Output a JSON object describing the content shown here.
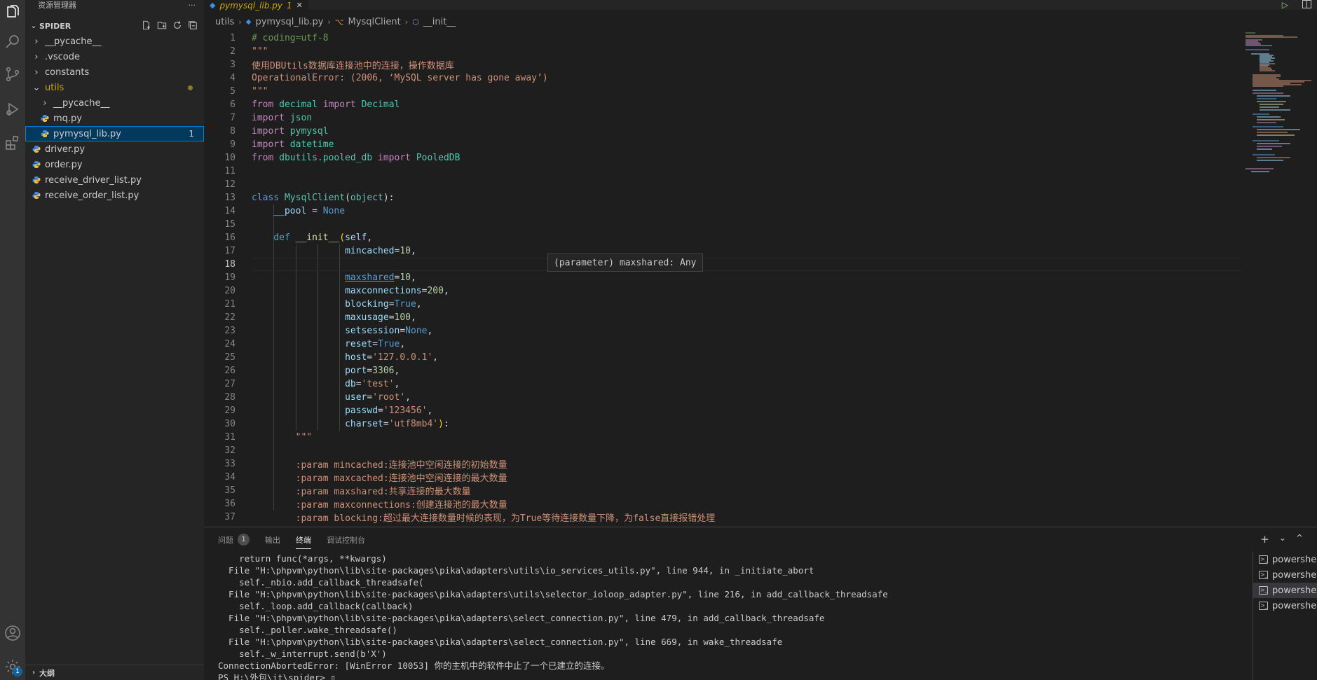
{
  "colors": {
    "accent": "#007fd4",
    "modified": "#cca700",
    "activity_bg": "#333333",
    "sidebar_bg": "#252526",
    "editor_bg": "#1e1e1e"
  },
  "activity_bar": {
    "items": [
      {
        "name": "explorer-icon"
      },
      {
        "name": "search-icon"
      },
      {
        "name": "source-control-icon"
      },
      {
        "name": "run-debug-icon"
      },
      {
        "name": "extensions-icon"
      }
    ],
    "bottom": [
      {
        "name": "account-icon"
      },
      {
        "name": "manage-gear-icon",
        "badge": "1"
      }
    ]
  },
  "sidebar": {
    "title": "资源管理器",
    "more": "···",
    "workspace": "SPIDER",
    "tree": [
      {
        "label": "__pycache__",
        "type": "folder",
        "depth": 0
      },
      {
        "label": ".vscode",
        "type": "folder",
        "depth": 0
      },
      {
        "label": "constants",
        "type": "folder",
        "depth": 0
      },
      {
        "label": "utils",
        "type": "folder-open",
        "depth": 0,
        "modified": true
      },
      {
        "label": "__pycache__",
        "type": "folder",
        "depth": 1
      },
      {
        "label": "mq.py",
        "type": "py",
        "depth": 1
      },
      {
        "label": "pymysql_lib.py",
        "type": "py",
        "depth": 1,
        "selected": true,
        "badge": "1"
      },
      {
        "label": "driver.py",
        "type": "py",
        "depth": 0
      },
      {
        "label": "order.py",
        "type": "py",
        "depth": 0
      },
      {
        "label": "receive_driver_list.py",
        "type": "py",
        "depth": 0
      },
      {
        "label": "receive_order_list.py",
        "type": "py",
        "depth": 0
      }
    ],
    "outline": "大纲"
  },
  "editor": {
    "tab": {
      "label": "pymysql_lib.py",
      "badge": "1",
      "close": "✕"
    },
    "breadcrumb": [
      "utils",
      "pymysql_lib.py",
      "MysqlClient",
      "__init__"
    ],
    "hover": "(parameter) maxshared: Any",
    "current_line": 18,
    "lines": [
      {
        "n": "1",
        "t": [
          [
            "c",
            "# coding=utf-8"
          ]
        ]
      },
      {
        "n": "2",
        "t": [
          [
            "s",
            "\"\"\""
          ]
        ]
      },
      {
        "n": "3",
        "t": [
          [
            "s",
            "使用DBUtils数据库连接池中的连接，操作数据库"
          ]
        ]
      },
      {
        "n": "4",
        "t": [
          [
            "s",
            "OperationalError: (2006, ‘MySQL server has gone away’)"
          ]
        ]
      },
      {
        "n": "5",
        "t": [
          [
            "s",
            "\"\"\""
          ]
        ]
      },
      {
        "n": "6",
        "t": [
          [
            "k",
            "from"
          ],
          [
            "p",
            " "
          ],
          [
            "cls",
            "decimal"
          ],
          [
            "p",
            " "
          ],
          [
            "k",
            "import"
          ],
          [
            "p",
            " "
          ],
          [
            "cls",
            "Decimal"
          ]
        ]
      },
      {
        "n": "7",
        "t": [
          [
            "k",
            "import"
          ],
          [
            "p",
            " "
          ],
          [
            "cls",
            "json"
          ]
        ]
      },
      {
        "n": "8",
        "t": [
          [
            "k",
            "import"
          ],
          [
            "p",
            " "
          ],
          [
            "cls",
            "pymysql"
          ]
        ]
      },
      {
        "n": "9",
        "t": [
          [
            "k",
            "import"
          ],
          [
            "p",
            " "
          ],
          [
            "cls",
            "datetime"
          ]
        ]
      },
      {
        "n": "10",
        "t": [
          [
            "k",
            "from"
          ],
          [
            "p",
            " "
          ],
          [
            "cls",
            "dbutils.pooled_db"
          ],
          [
            "p",
            " "
          ],
          [
            "k",
            "import"
          ],
          [
            "p",
            " "
          ],
          [
            "cls",
            "PooledDB"
          ]
        ]
      },
      {
        "n": "11",
        "t": []
      },
      {
        "n": "12",
        "t": []
      },
      {
        "n": "13",
        "t": [
          [
            "kb",
            "class"
          ],
          [
            "p",
            " "
          ],
          [
            "cls",
            "MysqlClient"
          ],
          [
            "p",
            "("
          ],
          [
            "cls",
            "object"
          ],
          [
            "p",
            "):"
          ]
        ]
      },
      {
        "n": "14",
        "t": [
          [
            "p",
            "    "
          ],
          [
            "v",
            "__pool"
          ],
          [
            "p",
            " = "
          ],
          [
            "cn",
            "None"
          ]
        ]
      },
      {
        "n": "15",
        "t": []
      },
      {
        "n": "16",
        "t": [
          [
            "p",
            "    "
          ],
          [
            "kb",
            "def"
          ],
          [
            "p",
            " "
          ],
          [
            "fn",
            "__init__"
          ],
          [
            "br",
            "("
          ],
          [
            "v",
            "self"
          ],
          [
            "p",
            ","
          ]
        ]
      },
      {
        "n": "17",
        "t": [
          [
            "p",
            "                 "
          ],
          [
            "v",
            "mincached"
          ],
          [
            "p",
            "="
          ],
          [
            "n",
            "10"
          ],
          [
            "p",
            ","
          ]
        ]
      },
      {
        "n": "18",
        "t": []
      },
      {
        "n": "19",
        "t": [
          [
            "p",
            "                 "
          ],
          [
            "v",
            "maxshared"
          ],
          [
            "p",
            "="
          ],
          [
            "n",
            "10"
          ],
          [
            "p",
            ","
          ]
        ]
      },
      {
        "n": "20",
        "t": [
          [
            "p",
            "                 "
          ],
          [
            "v",
            "maxconnections"
          ],
          [
            "p",
            "="
          ],
          [
            "n",
            "200"
          ],
          [
            "p",
            ","
          ]
        ]
      },
      {
        "n": "21",
        "t": [
          [
            "p",
            "                 "
          ],
          [
            "v",
            "blocking"
          ],
          [
            "p",
            "="
          ],
          [
            "cn",
            "True"
          ],
          [
            "p",
            ","
          ]
        ]
      },
      {
        "n": "22",
        "t": [
          [
            "p",
            "                 "
          ],
          [
            "v",
            "maxusage"
          ],
          [
            "p",
            "="
          ],
          [
            "n",
            "100"
          ],
          [
            "p",
            ","
          ]
        ]
      },
      {
        "n": "23",
        "t": [
          [
            "p",
            "                 "
          ],
          [
            "v",
            "setsession"
          ],
          [
            "p",
            "="
          ],
          [
            "cn",
            "None"
          ],
          [
            "p",
            ","
          ]
        ]
      },
      {
        "n": "24",
        "t": [
          [
            "p",
            "                 "
          ],
          [
            "v",
            "reset"
          ],
          [
            "p",
            "="
          ],
          [
            "cn",
            "True"
          ],
          [
            "p",
            ","
          ]
        ]
      },
      {
        "n": "25",
        "t": [
          [
            "p",
            "                 "
          ],
          [
            "v",
            "host"
          ],
          [
            "p",
            "="
          ],
          [
            "s",
            "'127.0.0.1'"
          ],
          [
            "p",
            ","
          ]
        ]
      },
      {
        "n": "26",
        "t": [
          [
            "p",
            "                 "
          ],
          [
            "v",
            "port"
          ],
          [
            "p",
            "="
          ],
          [
            "n",
            "3306"
          ],
          [
            "p",
            ","
          ]
        ]
      },
      {
        "n": "27",
        "t": [
          [
            "p",
            "                 "
          ],
          [
            "v",
            "db"
          ],
          [
            "p",
            "="
          ],
          [
            "s",
            "'test'"
          ],
          [
            "p",
            ","
          ]
        ]
      },
      {
        "n": "28",
        "t": [
          [
            "p",
            "                 "
          ],
          [
            "v",
            "user"
          ],
          [
            "p",
            "="
          ],
          [
            "s",
            "'root'"
          ],
          [
            "p",
            ","
          ]
        ]
      },
      {
        "n": "29",
        "t": [
          [
            "p",
            "                 "
          ],
          [
            "v",
            "passwd"
          ],
          [
            "p",
            "="
          ],
          [
            "s",
            "'123456'"
          ],
          [
            "p",
            ","
          ]
        ]
      },
      {
        "n": "30",
        "t": [
          [
            "p",
            "                 "
          ],
          [
            "v",
            "charset"
          ],
          [
            "p",
            "="
          ],
          [
            "s",
            "'utf8mb4'"
          ],
          [
            "br",
            ")"
          ],
          [
            "p",
            ":"
          ]
        ]
      },
      {
        "n": "31",
        "t": [
          [
            "p",
            "        "
          ],
          [
            "s",
            "\"\"\""
          ]
        ]
      },
      {
        "n": "32",
        "t": []
      },
      {
        "n": "33",
        "t": [
          [
            "p",
            "        "
          ],
          [
            "s",
            ":param mincached:连接池中空闲连接的初始数量"
          ]
        ]
      },
      {
        "n": "34",
        "t": [
          [
            "p",
            "        "
          ],
          [
            "s",
            ":param maxcached:连接池中空闲连接的最大数量"
          ]
        ]
      },
      {
        "n": "35",
        "t": [
          [
            "p",
            "        "
          ],
          [
            "s",
            ":param maxshared:共享连接的最大数量"
          ]
        ]
      },
      {
        "n": "36",
        "t": [
          [
            "p",
            "        "
          ],
          [
            "s",
            ":param maxconnections:创建连接池的最大数量"
          ]
        ]
      },
      {
        "n": "37",
        "t": [
          [
            "p",
            "        "
          ],
          [
            "s",
            ":param blocking:超过最大连接数量时候的表现，为True等待连接数量下降，为false直接报错处理"
          ]
        ]
      }
    ]
  },
  "panel": {
    "tabs": [
      {
        "label": "问题",
        "badge": "1"
      },
      {
        "label": "输出"
      },
      {
        "label": "终端",
        "active": true
      },
      {
        "label": "调试控制台"
      }
    ],
    "actions": [
      "+",
      "⌄",
      "^"
    ],
    "terminal_lines": [
      "    return func(*args, **kwargs)",
      "  File \"H:\\phpvm\\python\\lib\\site-packages\\pika\\adapters\\utils\\io_services_utils.py\", line 944, in _initiate_abort",
      "    self._nbio.add_callback_threadsafe(",
      "  File \"H:\\phpvm\\python\\lib\\site-packages\\pika\\adapters\\utils\\selector_ioloop_adapter.py\", line 216, in add_callback_threadsafe",
      "    self._loop.add_callback(callback)",
      "  File \"H:\\phpvm\\python\\lib\\site-packages\\pika\\adapters\\select_connection.py\", line 479, in add_callback_threadsafe",
      "    self._poller.wake_threadsafe()",
      "  File \"H:\\phpvm\\python\\lib\\site-packages\\pika\\adapters\\select_connection.py\", line 669, in wake_threadsafe",
      "    self._w_interrupt.send(b'X')",
      "ConnectionAbortedError: [WinError 10053] 你的主机中的软件中止了一个已建立的连接。",
      "PS H:\\外包\\it\\spider> ▯"
    ],
    "terminals": [
      {
        "label": "powershell"
      },
      {
        "label": "powershell"
      },
      {
        "label": "powershell",
        "selected": true
      },
      {
        "label": "powershell"
      }
    ]
  }
}
